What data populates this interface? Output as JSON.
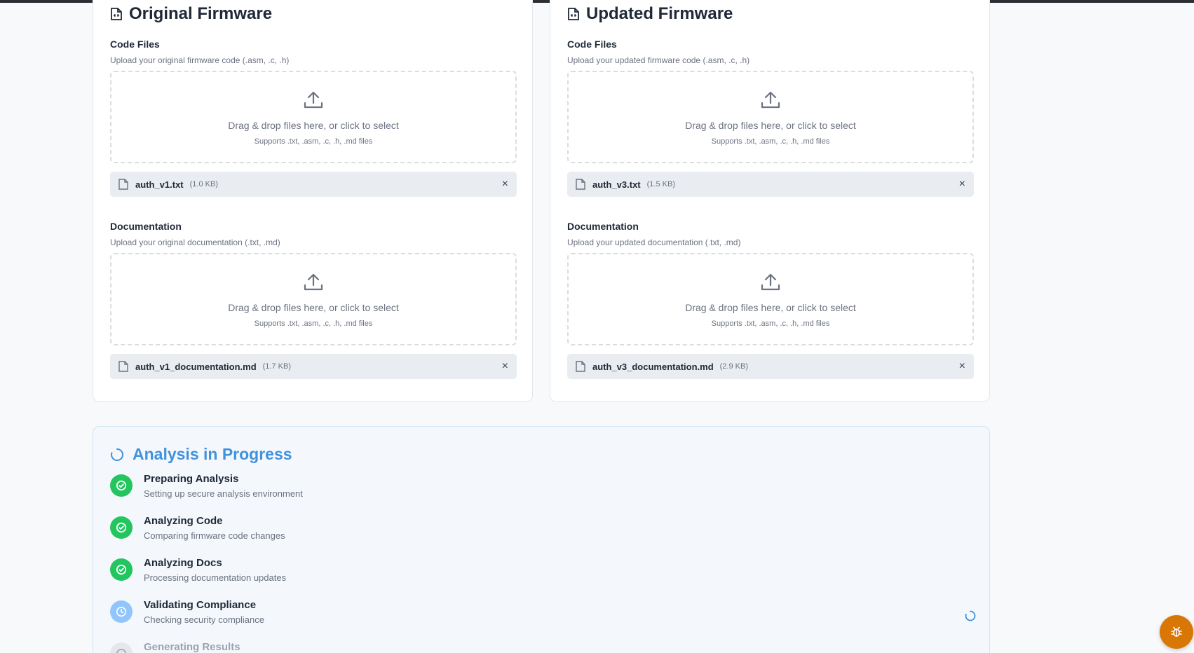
{
  "original": {
    "title": "Original Firmware",
    "code": {
      "label": "Code Files",
      "hint": "Upload your original firmware code (.asm, .c, .h)",
      "drop_main": "Drag & drop files here, or click to select",
      "drop_sub": "Supports .txt, .asm, .c, .h, .md files",
      "file_name": "auth_v1.txt",
      "file_size": "(1.0 KB)"
    },
    "docs": {
      "label": "Documentation",
      "hint": "Upload your original documentation (.txt, .md)",
      "drop_main": "Drag & drop files here, or click to select",
      "drop_sub": "Supports .txt, .asm, .c, .h, .md files",
      "file_name": "auth_v1_documentation.md",
      "file_size": "(1.7 KB)"
    }
  },
  "updated": {
    "title": "Updated Firmware",
    "code": {
      "label": "Code Files",
      "hint": "Upload your updated firmware code (.asm, .c, .h)",
      "drop_main": "Drag & drop files here, or click to select",
      "drop_sub": "Supports .txt, .asm, .c, .h, .md files",
      "file_name": "auth_v3.txt",
      "file_size": "(1.5 KB)"
    },
    "docs": {
      "label": "Documentation",
      "hint": "Upload your updated documentation (.txt, .md)",
      "drop_main": "Drag & drop files here, or click to select",
      "drop_sub": "Supports .txt, .asm, .c, .h, .md files",
      "file_name": "auth_v3_documentation.md",
      "file_size": "(2.9 KB)"
    }
  },
  "remove_symbol": "×",
  "progress": {
    "title": "Analysis in Progress",
    "steps": [
      {
        "title": "Preparing Analysis",
        "desc": "Setting up secure analysis environment",
        "status": "done"
      },
      {
        "title": "Analyzing Code",
        "desc": "Comparing firmware code changes",
        "status": "done"
      },
      {
        "title": "Analyzing Docs",
        "desc": "Processing documentation updates",
        "status": "done"
      },
      {
        "title": "Validating Compliance",
        "desc": "Checking security compliance",
        "status": "active"
      },
      {
        "title": "Generating Results",
        "desc": "",
        "status": "pending"
      }
    ]
  },
  "colors": {
    "accent": "#4191dd",
    "success": "#22c55e",
    "active": "#93c5fd",
    "fab": "#d97706"
  },
  "icons": {
    "card_title": "file-code-icon",
    "upload": "upload-icon",
    "file": "file-icon",
    "close": "close-icon",
    "done": "check-circle-icon",
    "active": "clock-icon",
    "spinner": "spinner-icon",
    "fab": "bug-icon"
  }
}
